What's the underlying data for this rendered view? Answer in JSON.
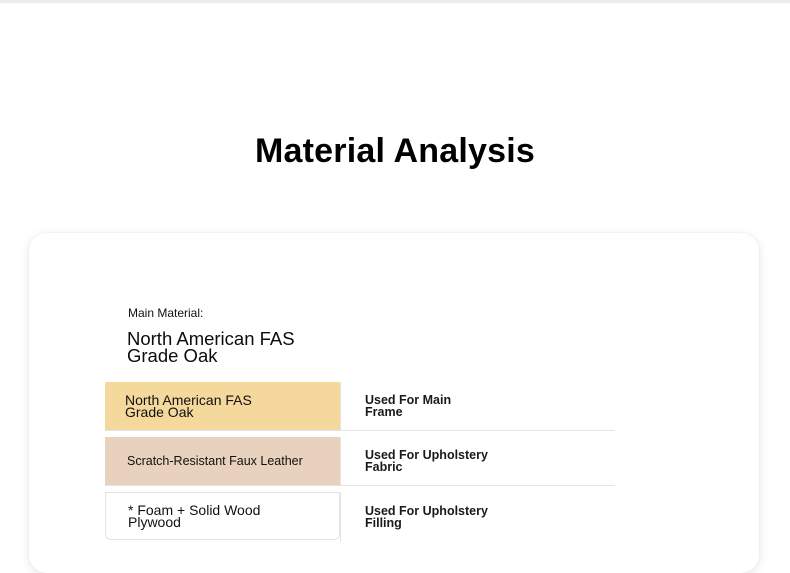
{
  "page": {
    "title": "Material Analysis"
  },
  "card": {
    "main_label": "Main Material:",
    "main_value": "North American FAS Grade Oak"
  },
  "materials": [
    {
      "name": "North American FAS Grade Oak",
      "use": "Used For Main Frame",
      "color": "#f4d89c"
    },
    {
      "name": "Scratch-Resistant Faux Leather",
      "use": "Used For Upholstery Fabric",
      "color": "#e8d2bd"
    },
    {
      "name": "* Foam + Solid Wood Plywood",
      "use": "Used For Upholstery Filling",
      "color": "#ffffff"
    }
  ]
}
